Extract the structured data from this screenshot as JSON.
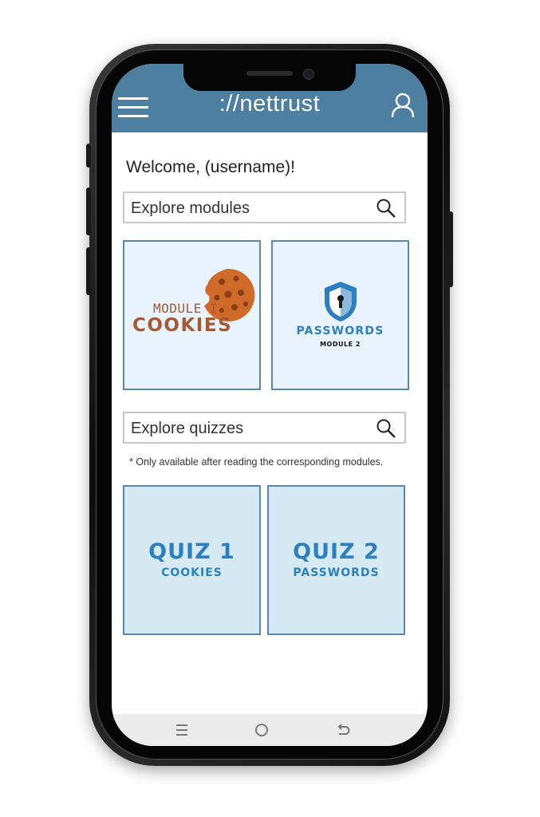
{
  "header": {
    "brand": "://nettrust",
    "menu_icon": "hamburger-menu-icon",
    "profile_icon": "user-profile-icon",
    "color": "#4d7fa1"
  },
  "welcome": "Welcome, (username)!",
  "modules_search": {
    "placeholder": "Explore modules",
    "icon": "search-icon"
  },
  "modules": [
    {
      "title": "MODULE I",
      "name": "COOKIES",
      "image": "cookie-icon"
    },
    {
      "title": "PASSWORDS",
      "name": "MODULE 2",
      "image": "shield-keyhole-icon"
    }
  ],
  "quizzes_search": {
    "placeholder": "Explore quizzes",
    "icon": "search-icon"
  },
  "quiz_note": "* Only available after reading the corresponding modules.",
  "quizzes": [
    {
      "title": "QUIZ 1",
      "subtitle": "COOKIES"
    },
    {
      "title": "QUIZ 2",
      "subtitle": "PASSWORDS"
    }
  ],
  "colors": {
    "tile_border": "#5b87ad",
    "quiz_text": "#2c7fc1",
    "cookie": "#d06a28",
    "cookie_text": "#a45a35"
  },
  "bottom_nav": [
    "recent-apps-icon",
    "home-icon",
    "back-icon"
  ]
}
